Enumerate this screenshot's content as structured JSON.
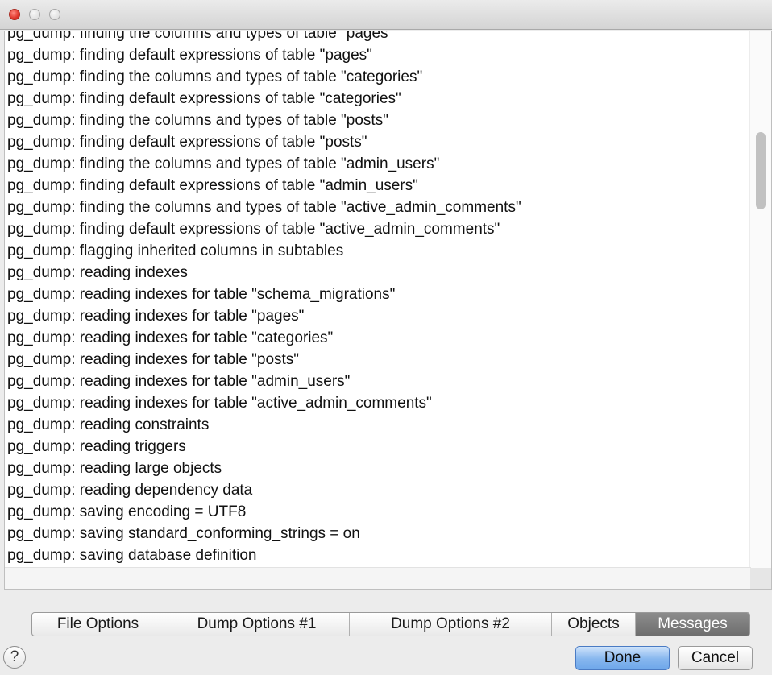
{
  "window": {
    "traffic_lights": [
      "close",
      "minimize",
      "zoom"
    ]
  },
  "log": {
    "lines": [
      "pg_dump: finding the columns and types of table \"pages\"",
      "pg_dump: finding default expressions of table \"pages\"",
      "pg_dump: finding the columns and types of table \"categories\"",
      "pg_dump: finding default expressions of table \"categories\"",
      "pg_dump: finding the columns and types of table \"posts\"",
      "pg_dump: finding default expressions of table \"posts\"",
      "pg_dump: finding the columns and types of table \"admin_users\"",
      "pg_dump: finding default expressions of table \"admin_users\"",
      "pg_dump: finding the columns and types of table \"active_admin_comments\"",
      "pg_dump: finding default expressions of table \"active_admin_comments\"",
      "pg_dump: flagging inherited columns in subtables",
      "pg_dump: reading indexes",
      "pg_dump: reading indexes for table \"schema_migrations\"",
      "pg_dump: reading indexes for table \"pages\"",
      "pg_dump: reading indexes for table \"categories\"",
      "pg_dump: reading indexes for table \"posts\"",
      "pg_dump: reading indexes for table \"admin_users\"",
      "pg_dump: reading indexes for table \"active_admin_comments\"",
      "pg_dump: reading constraints",
      "pg_dump: reading triggers",
      "pg_dump: reading large objects",
      "pg_dump: reading dependency data",
      "pg_dump: saving encoding = UTF8",
      "pg_dump: saving standard_conforming_strings = on",
      "pg_dump: saving database definition"
    ]
  },
  "tabs": [
    {
      "label": "File Options",
      "active": false
    },
    {
      "label": "Dump Options #1",
      "active": false
    },
    {
      "label": "Dump Options #2",
      "active": false
    },
    {
      "label": "Objects",
      "active": false
    },
    {
      "label": "Messages",
      "active": true
    }
  ],
  "help": {
    "label": "?",
    "icon": "help-icon"
  },
  "buttons": {
    "done": "Done",
    "cancel": "Cancel"
  },
  "colors": {
    "default_button": "#86b6ee",
    "active_tab": "#7d7d7d",
    "close_light": "#e0352b"
  }
}
